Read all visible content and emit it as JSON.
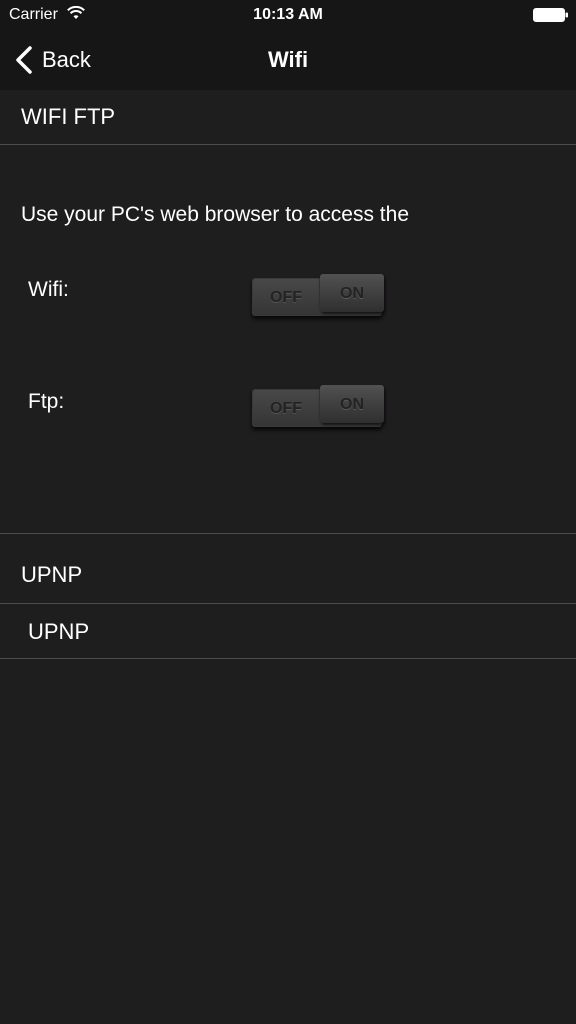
{
  "status_bar": {
    "carrier": "Carrier",
    "time": "10:13 AM",
    "wifi_icon": "wifi-icon",
    "battery_icon": "battery-icon"
  },
  "nav": {
    "back_label": "Back",
    "title": "Wifi"
  },
  "wifi_ftp_section": {
    "header": "WIFI FTP",
    "description": "Use your PC's web browser to access the",
    "wifi_label": "Wifi:",
    "ftp_label": "Ftp:",
    "wifi_toggle": {
      "off_label": "OFF",
      "on_label": "ON",
      "state": "on"
    },
    "ftp_toggle": {
      "off_label": "OFF",
      "on_label": "ON",
      "state": "on"
    }
  },
  "upnp_section": {
    "header": "UPNP",
    "items": [
      {
        "label": "UPNP"
      }
    ]
  },
  "colors": {
    "background": "#1f1e1f",
    "bar_background": "#161616",
    "divider": "#4d4c4d",
    "text": "#ffffff"
  }
}
